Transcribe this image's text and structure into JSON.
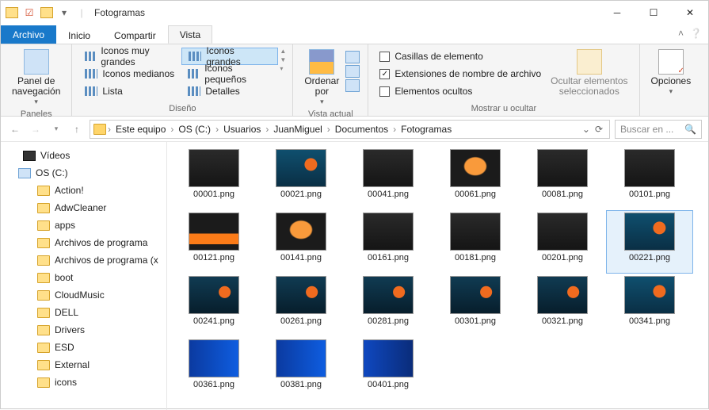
{
  "window": {
    "title": "Fotogramas"
  },
  "tabs": {
    "file": "Archivo",
    "home": "Inicio",
    "share": "Compartir",
    "view": "Vista"
  },
  "ribbon": {
    "panes": {
      "nav_pane": "Panel de\nnavegación",
      "group": "Paneles"
    },
    "layout": {
      "extra_large": "Iconos muy grandes",
      "large": "Iconos grandes",
      "medium": "Iconos medianos",
      "small": "Iconos pequeños",
      "list": "Lista",
      "details": "Detalles",
      "group": "Diseño"
    },
    "current_view": {
      "sort_by": "Ordenar\npor",
      "group": "Vista actual"
    },
    "showhide": {
      "item_checkboxes": "Casillas de elemento",
      "file_ext": "Extensiones de nombre de archivo",
      "hidden": "Elementos ocultos",
      "hide_selected": "Ocultar elementos\nseleccionados",
      "group": "Mostrar u ocultar"
    },
    "options": "Opciones"
  },
  "breadcrumb": {
    "items": [
      "Este equipo",
      "OS (C:)",
      "Usuarios",
      "JuanMiguel",
      "Documentos",
      "Fotogramas"
    ]
  },
  "search": {
    "placeholder": "Buscar en ..."
  },
  "tree": {
    "videos": "Vídeos",
    "drive": "OS (C:)",
    "folders": [
      "Action!",
      "AdwCleaner",
      "apps",
      "Archivos de programa",
      "Archivos de programa (x",
      "boot",
      "CloudMusic",
      "DELL",
      "Drivers",
      "ESD",
      "External",
      "icons"
    ]
  },
  "files": [
    {
      "name": "00001.png",
      "style": "dark"
    },
    {
      "name": "00021.png",
      "style": "desk"
    },
    {
      "name": "00041.png",
      "style": "dark"
    },
    {
      "name": "00061.png",
      "style": "logo"
    },
    {
      "name": "00081.png",
      "style": "dark"
    },
    {
      "name": "00101.png",
      "style": "dark"
    },
    {
      "name": "00121.png",
      "style": "fire"
    },
    {
      "name": "00141.png",
      "style": "logo"
    },
    {
      "name": "00161.png",
      "style": "dark"
    },
    {
      "name": "00181.png",
      "style": "dark"
    },
    {
      "name": "00201.png",
      "style": "dark"
    },
    {
      "name": "00221.png",
      "style": "desk",
      "selected": true
    },
    {
      "name": "00241.png",
      "style": "desk2"
    },
    {
      "name": "00261.png",
      "style": "desk2"
    },
    {
      "name": "00281.png",
      "style": "desk2"
    },
    {
      "name": "00301.png",
      "style": "desk2"
    },
    {
      "name": "00321.png",
      "style": "desk2"
    },
    {
      "name": "00341.png",
      "style": "desk"
    },
    {
      "name": "00361.png",
      "style": "blue"
    },
    {
      "name": "00381.png",
      "style": "blue"
    },
    {
      "name": "00401.png",
      "style": "blue2"
    }
  ]
}
